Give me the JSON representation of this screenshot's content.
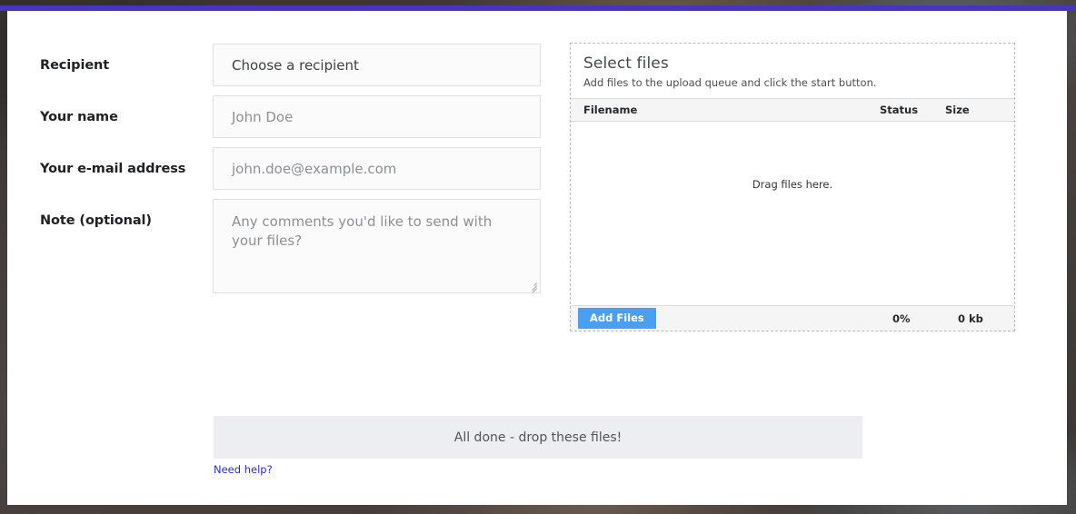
{
  "theme": {
    "accent_bar": "#4733c4",
    "button_blue": "#4a9ff0",
    "link_blue": "#2b2bdd",
    "panel_bg": "#ffffff",
    "dropbar_bg": "#eceef1"
  },
  "form": {
    "fields": [
      {
        "label": "Recipient",
        "type": "select",
        "value": "Choose a recipient",
        "placeholder": "Choose a recipient",
        "filled": true
      },
      {
        "label": "Your name",
        "type": "text",
        "value": "",
        "placeholder": "John Doe",
        "filled": false
      },
      {
        "label": "Your e-mail address",
        "type": "email",
        "value": "",
        "placeholder": "john.doe@example.com",
        "filled": false
      },
      {
        "label": "Note (optional)",
        "type": "textarea",
        "value": "",
        "placeholder": "Any comments you'd like to send with your files?",
        "filled": false
      }
    ]
  },
  "uploader": {
    "title": "Select files",
    "subtitle": "Add files to the upload queue and click the start button.",
    "columns": {
      "filename": "Filename",
      "status": "Status",
      "size": "Size"
    },
    "rows": [],
    "drop_message": "Drag files here.",
    "add_files_label": "Add Files",
    "progress_percent": "0%",
    "total_size": "0 kb"
  },
  "dropzone": {
    "message": "All done - drop these files!"
  },
  "help": {
    "label": "Need help?"
  }
}
